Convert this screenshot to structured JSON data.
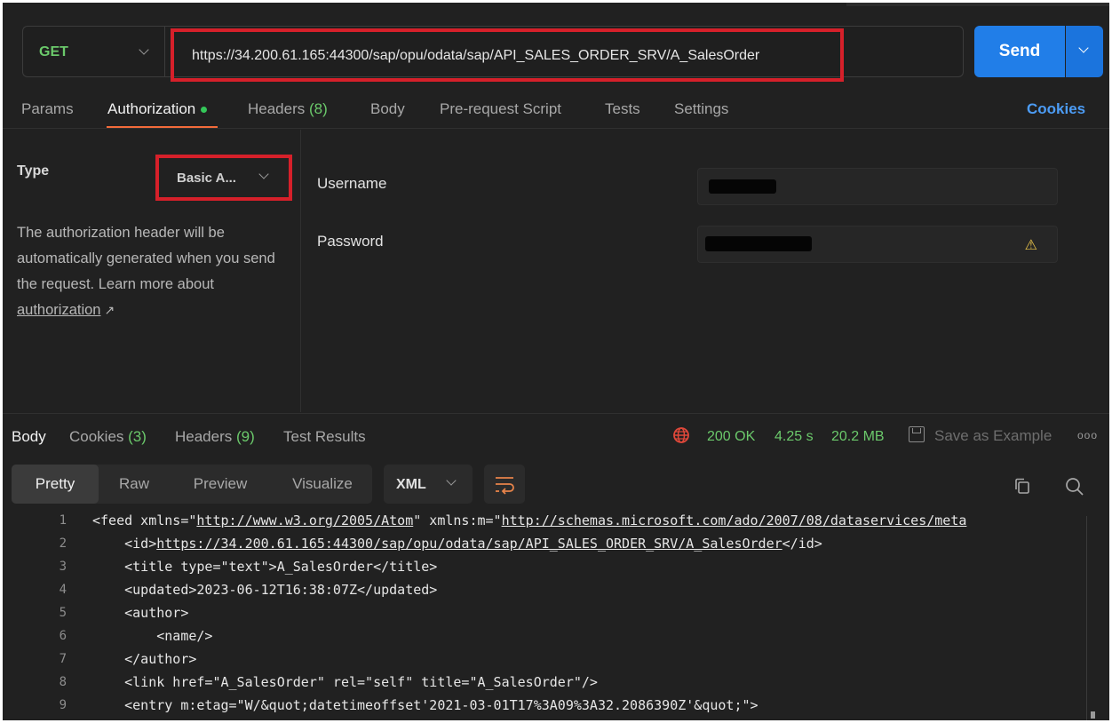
{
  "request": {
    "method": "GET",
    "url": "https://34.200.61.165:44300/sap/opu/odata/sap/API_SALES_ORDER_SRV/A_SalesOrder",
    "send_label": "Send"
  },
  "tabs": [
    {
      "label": "Params"
    },
    {
      "label": "Authorization"
    },
    {
      "label": "Headers ",
      "count": "(8)"
    },
    {
      "label": "Body"
    },
    {
      "label": "Pre-request Script"
    },
    {
      "label": "Tests"
    },
    {
      "label": "Settings"
    }
  ],
  "cookies_link": "Cookies",
  "auth": {
    "type_label": "Type",
    "type_value": "Basic A...",
    "description": "The authorization header will be automatically generated when you send the request. Learn more about ",
    "learn_link": "authorization",
    "username_label": "Username",
    "password_label": "Password"
  },
  "response": {
    "tabs": [
      {
        "label": "Body"
      },
      {
        "label": "Cookies ",
        "count": "(3)"
      },
      {
        "label": "Headers ",
        "count": "(9)"
      },
      {
        "label": "Test Results"
      }
    ],
    "status": "200 OK",
    "time": "4.25 s",
    "size": "20.2 MB",
    "save_label": "Save as Example",
    "more": "ooo",
    "views": [
      "Pretty",
      "Raw",
      "Preview",
      "Visualize"
    ],
    "format": "XML"
  },
  "code_lines": [
    {
      "n": "1",
      "pre": "<feed xmlns=\"",
      "link": "http://www.w3.org/2005/Atom",
      "mid": "\" xmlns:m=\"",
      "link2": "http://schemas.microsoft.com/ado/2007/08/dataservices/meta"
    },
    {
      "n": "2",
      "pre": "    <id>",
      "link": "https://34.200.61.165:44300/sap/opu/odata/sap/API_SALES_ORDER_SRV/A_SalesOrder",
      "mid": "</id>"
    },
    {
      "n": "3",
      "pre": "    <title type=\"text\">A_SalesOrder</title>"
    },
    {
      "n": "4",
      "pre": "    <updated>2023-06-12T16:38:07Z</updated>"
    },
    {
      "n": "5",
      "pre": "    <author>"
    },
    {
      "n": "6",
      "pre": "        <name/>"
    },
    {
      "n": "7",
      "pre": "    </author>"
    },
    {
      "n": "8",
      "pre": "    <link href=\"A_SalesOrder\" rel=\"self\" title=\"A_SalesOrder\"/>"
    },
    {
      "n": "9",
      "pre": "    <entry m:etag=\"W/&quot;datetimeoffset'2021-03-01T17%3A09%3A32.2086390Z'&quot;\">"
    }
  ]
}
